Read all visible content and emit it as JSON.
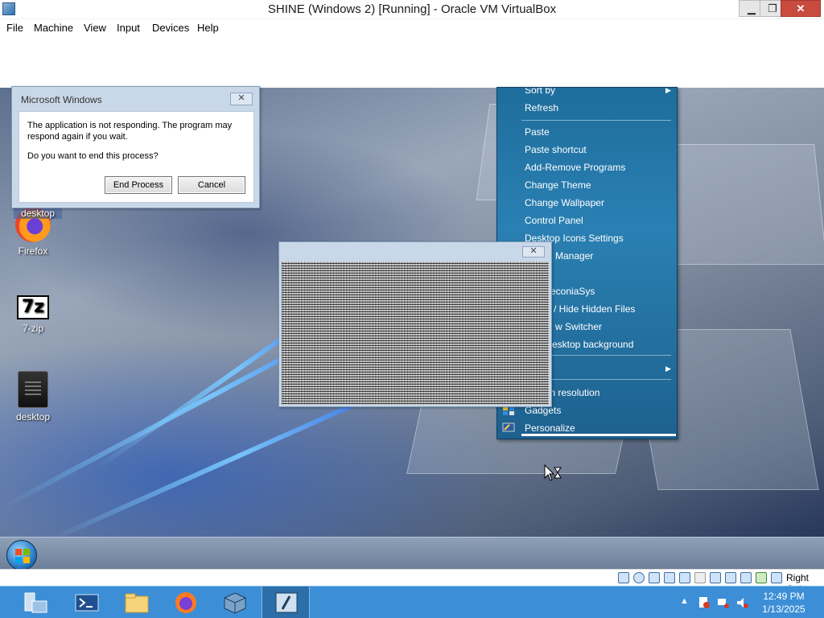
{
  "vbox": {
    "title": "SHINE (Windows 2) [Running] - Oracle VM VirtualBox",
    "menu": [
      "File",
      "Machine",
      "View",
      "Input",
      "Devices",
      "Help"
    ],
    "controls": {
      "minimize": "▁",
      "restore": "❐",
      "close": "✕"
    },
    "status_right": "Right Ctrl"
  },
  "desktop": {
    "icons": [
      {
        "label": "Firefox",
        "icon": "firefox-icon"
      },
      {
        "label": "7-zip",
        "icon": "7zip-icon",
        "glyph": "7z"
      },
      {
        "label": "desktop",
        "icon": "desktop-file-icon"
      }
    ],
    "partial_icon_label": "desktop"
  },
  "context_menu": {
    "items": [
      {
        "label": "Sort by",
        "submenu": true
      },
      {
        "label": "Refresh"
      },
      {
        "label": "Paste"
      },
      {
        "label": "Paste shortcut"
      },
      {
        "label": "Add-Remove Programs"
      },
      {
        "label": "Change Theme"
      },
      {
        "label": "Change Wallpaper"
      },
      {
        "label": "Control Panel"
      },
      {
        "label": "Desktop Icons Settings"
      },
      {
        "label": "Manager",
        "partial": true
      },
      {
        "label": "econiaSys",
        "partial": true
      },
      {
        "label": "/ Hide Hidden Files",
        "partial": true
      },
      {
        "label": "w Switcher",
        "partial": true
      },
      {
        "label": "esktop background",
        "partial": true
      },
      {
        "label": "",
        "submenu": true
      },
      {
        "label": "Screen resolution",
        "icon": "screen-resolution-icon"
      },
      {
        "label": "Gadgets",
        "icon": "gadgets-icon"
      },
      {
        "label": "Personalize",
        "icon": "personalize-icon"
      }
    ]
  },
  "dialog": {
    "title": "Microsoft Windows",
    "message1": "The application is not responding. The program may respond again if you wait.",
    "message2": "Do you want to end this process?",
    "buttons": {
      "end": "End Process",
      "cancel": "Cancel"
    },
    "close_glyph": "✕"
  },
  "noise_window": {
    "close_glyph": "✕"
  },
  "taskbar": {
    "apps": [
      {
        "name": "server-manager-icon"
      },
      {
        "name": "powershell-icon"
      },
      {
        "name": "file-explorer-icon"
      },
      {
        "name": "firefox-taskbar-icon"
      },
      {
        "name": "virtualbox-icon"
      },
      {
        "name": "vm-window-icon",
        "active": true
      }
    ],
    "tray_arrow": "▲",
    "clock": {
      "time": "12:49 PM",
      "date": "1/13/2025"
    }
  },
  "colors": {
    "menu_bg": "#2a80b3",
    "host_taskbar": "#3c8fd6",
    "dialog_frame": "#c9d8e8"
  }
}
